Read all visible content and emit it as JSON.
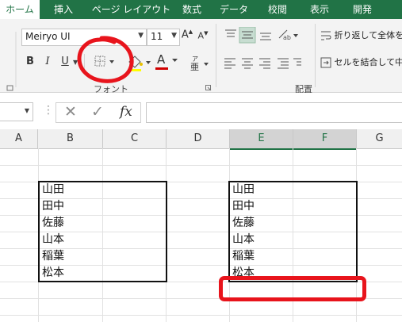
{
  "ribbon": {
    "tabs": [
      {
        "label": "ホーム"
      },
      {
        "label": "挿入"
      },
      {
        "label": "ページ レイアウト"
      },
      {
        "label": "数式"
      },
      {
        "label": "データ"
      },
      {
        "label": "校閲"
      },
      {
        "label": "表示"
      },
      {
        "label": "開発"
      }
    ],
    "font_name": "Meiryo UI",
    "font_size": "11",
    "grow_font": "A",
    "shrink_font": "A",
    "bold": "B",
    "italic": "I",
    "underline": "U",
    "font_color_letter": "A",
    "font_group_label": "フォント",
    "wrap_text_label": "折り返して全体を",
    "merge_center_label": "セルを結合して中",
    "alignment_group_label": "配置",
    "accent_color": "#217346",
    "annotation_color": "#e8141c",
    "font_color_bar": "#d00000"
  },
  "formula_bar": {
    "name_box": "",
    "cancel": "✕",
    "enter": "✓",
    "function": "fx",
    "content": ""
  },
  "grid": {
    "columns": [
      "A",
      "B",
      "C",
      "D",
      "E",
      "F",
      "G"
    ],
    "selected_columns": [
      "E",
      "F"
    ],
    "left_table": [
      "山田",
      "田中",
      "佐藤",
      "山本",
      "稲葉",
      "松本"
    ],
    "right_table": [
      "山田",
      "田中",
      "佐藤",
      "山本",
      "稲葉",
      "松本"
    ]
  }
}
